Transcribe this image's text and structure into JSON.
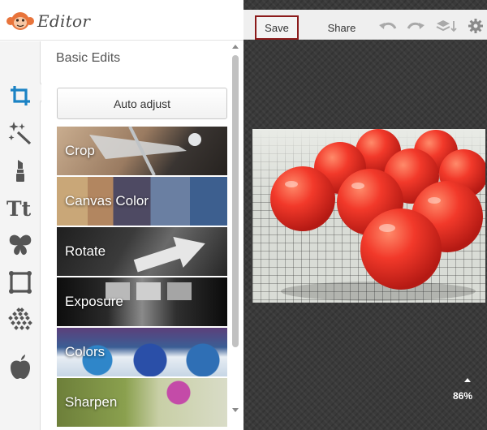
{
  "app": {
    "title": "Editor",
    "logo_icon": "monkey-logo"
  },
  "tool_rail": {
    "items": [
      {
        "name": "crop-tool",
        "icon": "crop-icon",
        "active": true
      },
      {
        "name": "effects-tool",
        "icon": "magic-wand-icon"
      },
      {
        "name": "touch-up-tool",
        "icon": "lipstick-icon"
      },
      {
        "name": "text-tool",
        "icon": "text-icon",
        "label": "Tt"
      },
      {
        "name": "overlays-tool",
        "icon": "butterfly-icon"
      },
      {
        "name": "frames-tool",
        "icon": "frame-icon"
      },
      {
        "name": "textures-tool",
        "icon": "texture-icon"
      },
      {
        "name": "seasonal-tool",
        "icon": "apple-icon"
      }
    ],
    "accent_color": "#1a82c4"
  },
  "panel": {
    "title": "Basic Edits",
    "auto_adjust_label": "Auto adjust",
    "tiles": [
      {
        "label": "Crop"
      },
      {
        "label": "Canvas Color"
      },
      {
        "label": "Rotate"
      },
      {
        "label": "Exposure"
      },
      {
        "label": "Colors"
      },
      {
        "label": "Sharpen"
      }
    ]
  },
  "toolbar": {
    "save_label": "Save",
    "share_label": "Share",
    "save_border_color": "#8b1a1a",
    "icons": [
      "undo-icon",
      "redo-icon",
      "layers-icon",
      "gear-icon"
    ]
  },
  "canvas": {
    "photo": "red tomatoes on checkered cloth",
    "zoom_label": "86%"
  }
}
